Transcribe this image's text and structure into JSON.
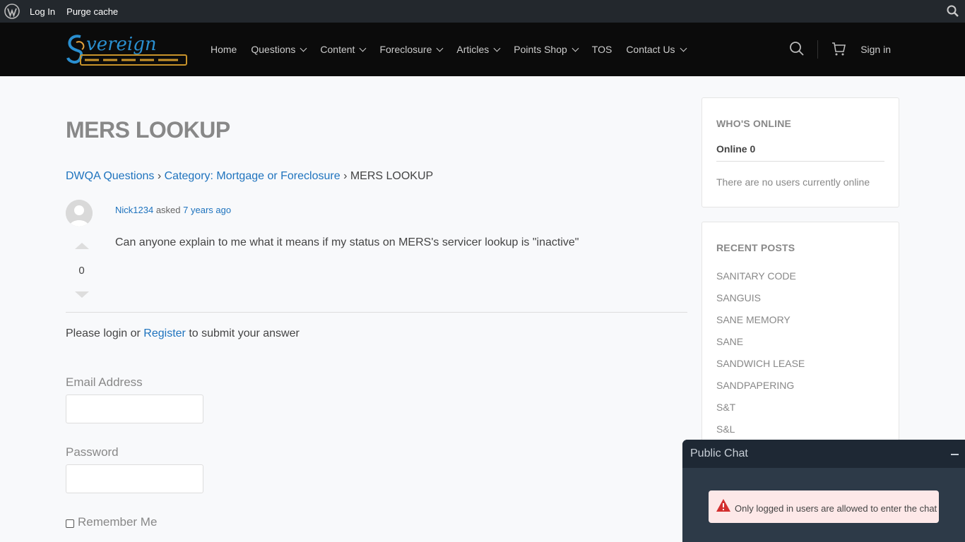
{
  "admin_bar": {
    "login_label": "Log In",
    "purge_label": "Purge cache"
  },
  "header": {
    "logo_alt": "Sovereign Connection",
    "nav": [
      {
        "label": "Home",
        "dropdown": false
      },
      {
        "label": "Questions",
        "dropdown": true
      },
      {
        "label": "Content",
        "dropdown": true
      },
      {
        "label": "Foreclosure",
        "dropdown": true
      },
      {
        "label": "Articles",
        "dropdown": true
      },
      {
        "label": "Points Shop",
        "dropdown": true
      },
      {
        "label": "TOS",
        "dropdown": false
      },
      {
        "label": "Contact Us",
        "dropdown": true
      }
    ],
    "signin_label": "Sign in"
  },
  "page": {
    "title": "MERS LOOKUP",
    "breadcrumb": {
      "root": "DWQA Questions",
      "sep": "›",
      "category": "Category: Mortgage or Foreclosure",
      "current": "MERS LOOKUP"
    }
  },
  "question": {
    "author": "Nick1234",
    "asked_text": "asked",
    "time": "7 years ago",
    "votes": "0",
    "body": "Can anyone explain to me what it means if my status on MERS's servicer lookup is \"inactive\""
  },
  "answer_login": {
    "prefix": "Please login or",
    "register": "Register",
    "suffix": "to submit your answer"
  },
  "login_form": {
    "email_label": "Email Address",
    "password_label": "Password",
    "remember_label": "Remember Me"
  },
  "sidebar": {
    "whos_online": {
      "heading": "WHO'S ONLINE",
      "count": "Online 0",
      "empty": "There are no users currently online"
    },
    "recent_posts": {
      "heading": "RECENT POSTS",
      "items": [
        "SANITARY CODE",
        "SANGUIS",
        "SANE MEMORY",
        "SANE",
        "SANDWICH LEASE",
        "SANDPAPERING",
        "S&T",
        "S&L"
      ]
    }
  },
  "chat": {
    "title": "Public Chat",
    "alert": "Only logged in users are allowed to enter the chat"
  },
  "colors": {
    "link": "#1e73be",
    "adminbar": "#23282d",
    "header": "#0b0b0b",
    "chat_alert_bg": "#fde8e8",
    "chat_alert_icon": "#d32f2f"
  }
}
